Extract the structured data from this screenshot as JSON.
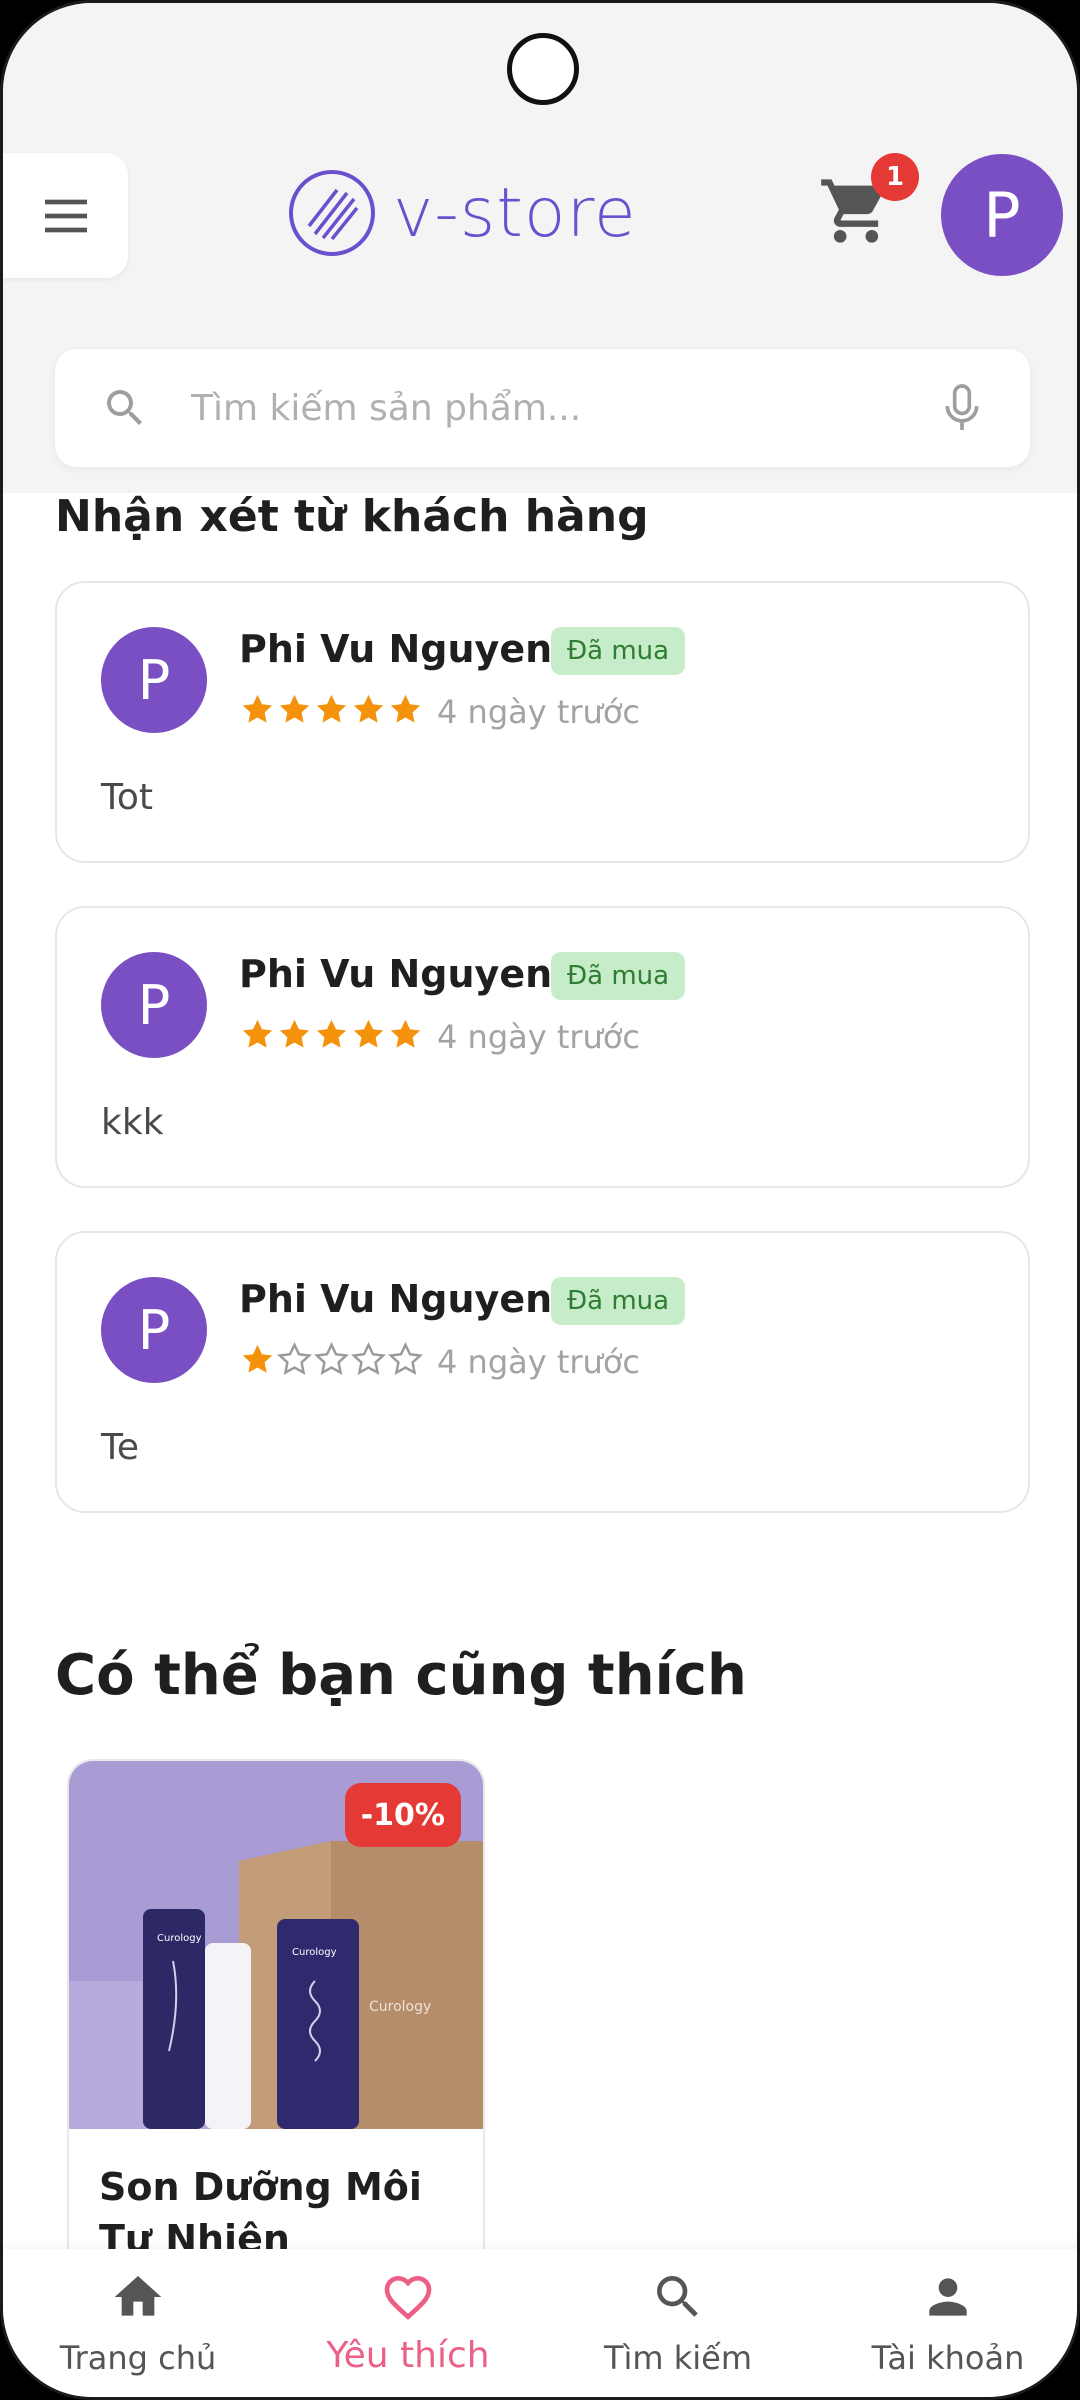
{
  "header": {
    "logo_text": "v-store",
    "cart_count": "1",
    "user_initial": "P"
  },
  "search": {
    "placeholder": "Tìm kiếm sản phẩm..."
  },
  "reviews_section": {
    "title": "Nhận xét từ khách hàng",
    "items": [
      {
        "initial": "P",
        "name": "Phi Vu Nguyen",
        "badge": "Đã mua",
        "rating": 5,
        "time": "4 ngày trước",
        "text": "Tot"
      },
      {
        "initial": "P",
        "name": "Phi Vu Nguyen",
        "badge": "Đã mua",
        "rating": 5,
        "time": "4 ngày trước",
        "text": "kkk"
      },
      {
        "initial": "P",
        "name": "Phi Vu Nguyen",
        "badge": "Đã mua",
        "rating": 1,
        "time": "4 ngày trước",
        "text": "Te"
      }
    ]
  },
  "suggestions": {
    "title": "Có thể bạn cũng thích",
    "products": [
      {
        "discount": "-10%",
        "name": "Son Dưỡng Môi Tư Nhiên"
      }
    ]
  },
  "bottom_nav": {
    "items": [
      {
        "label": "Trang chủ",
        "icon": "home-icon"
      },
      {
        "label": "Yêu thích",
        "icon": "heart-icon"
      },
      {
        "label": "Tìm kiếm",
        "icon": "search-icon"
      },
      {
        "label": "Tài khoản",
        "icon": "person-icon"
      }
    ],
    "active_index": 1
  },
  "colors": {
    "brand": "#6a4fcf",
    "avatar": "#7b4fc4",
    "star": "#f4920b",
    "badge_bg": "#c7ecc9",
    "badge_text": "#2e7d32",
    "discount": "#e53935",
    "nav_active": "#ec5f86"
  }
}
